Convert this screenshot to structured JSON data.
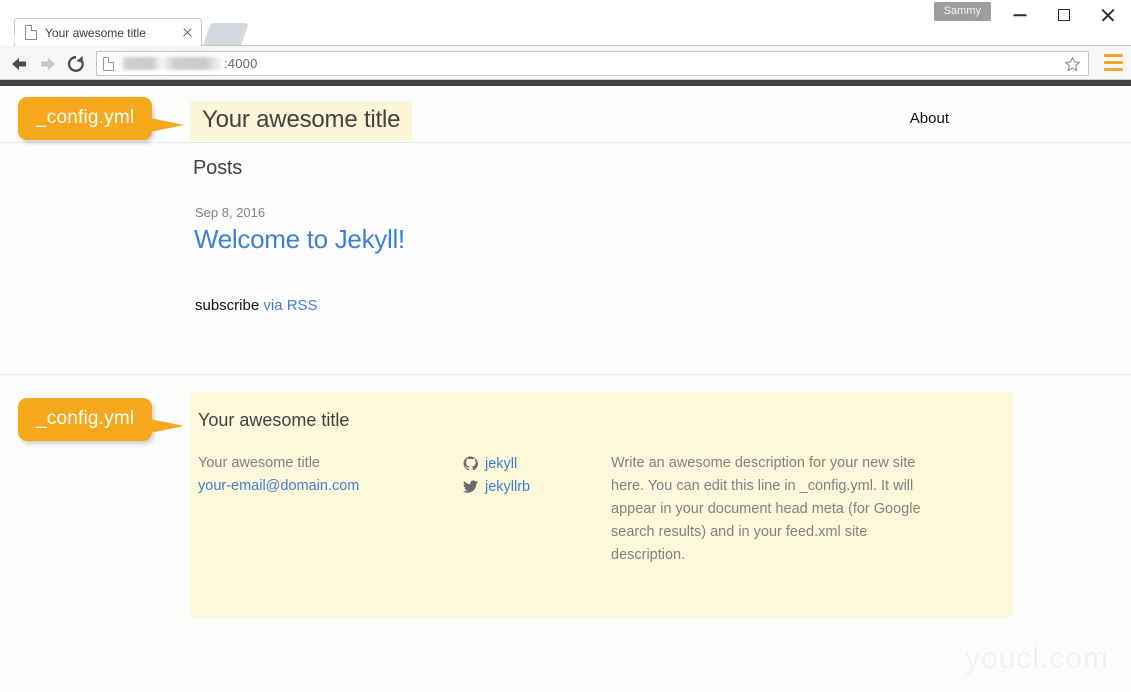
{
  "browser": {
    "tab": {
      "title": "Your awesome title",
      "favicon": "page-icon",
      "close": "close-icon"
    },
    "new_tab": "new-tab-button",
    "user_badge": "Sammy",
    "window_controls": {
      "minimize": "minimize-icon",
      "maximize": "maximize-icon",
      "close": "close-icon"
    },
    "nav": {
      "back": "back-arrow-icon",
      "forward": "forward-arrow-icon",
      "reload": "reload-icon"
    },
    "omnibox": {
      "url_port": ":4000",
      "url_redacted": true,
      "bookmark": "star-icon"
    },
    "menu": "hamburger-menu-icon"
  },
  "site": {
    "header": {
      "title": "Your awesome title",
      "nav_about": "About"
    },
    "main": {
      "posts_heading": "Posts",
      "post": {
        "date": "Sep 8, 2016",
        "title": "Welcome to Jekyll!"
      },
      "subscribe_text": "subscribe ",
      "subscribe_link": "via RSS"
    },
    "footer": {
      "heading": "Your awesome title",
      "contact_name": "Your awesome title",
      "email": "your-email@domain.com",
      "social": [
        {
          "icon": "github-icon",
          "label": "jekyll"
        },
        {
          "icon": "twitter-icon",
          "label": "jekyllrb"
        }
      ],
      "description": "Write an awesome description for your new site here. You can edit this line in _config.yml. It will appear in your document head meta (for Google search results) and in your feed.xml site description."
    }
  },
  "annotations": {
    "callout_header": "_config.yml",
    "callout_footer": "_config.yml"
  },
  "watermark": "youcl.com",
  "colors": {
    "accent_orange": "#f5a81c",
    "link_blue": "#3f7fd8",
    "highlight_yellow": "#fdf6d8",
    "footer_yellow": "#fcf8d9",
    "theme_stripe": "#424242",
    "muted_text": "#828282"
  }
}
